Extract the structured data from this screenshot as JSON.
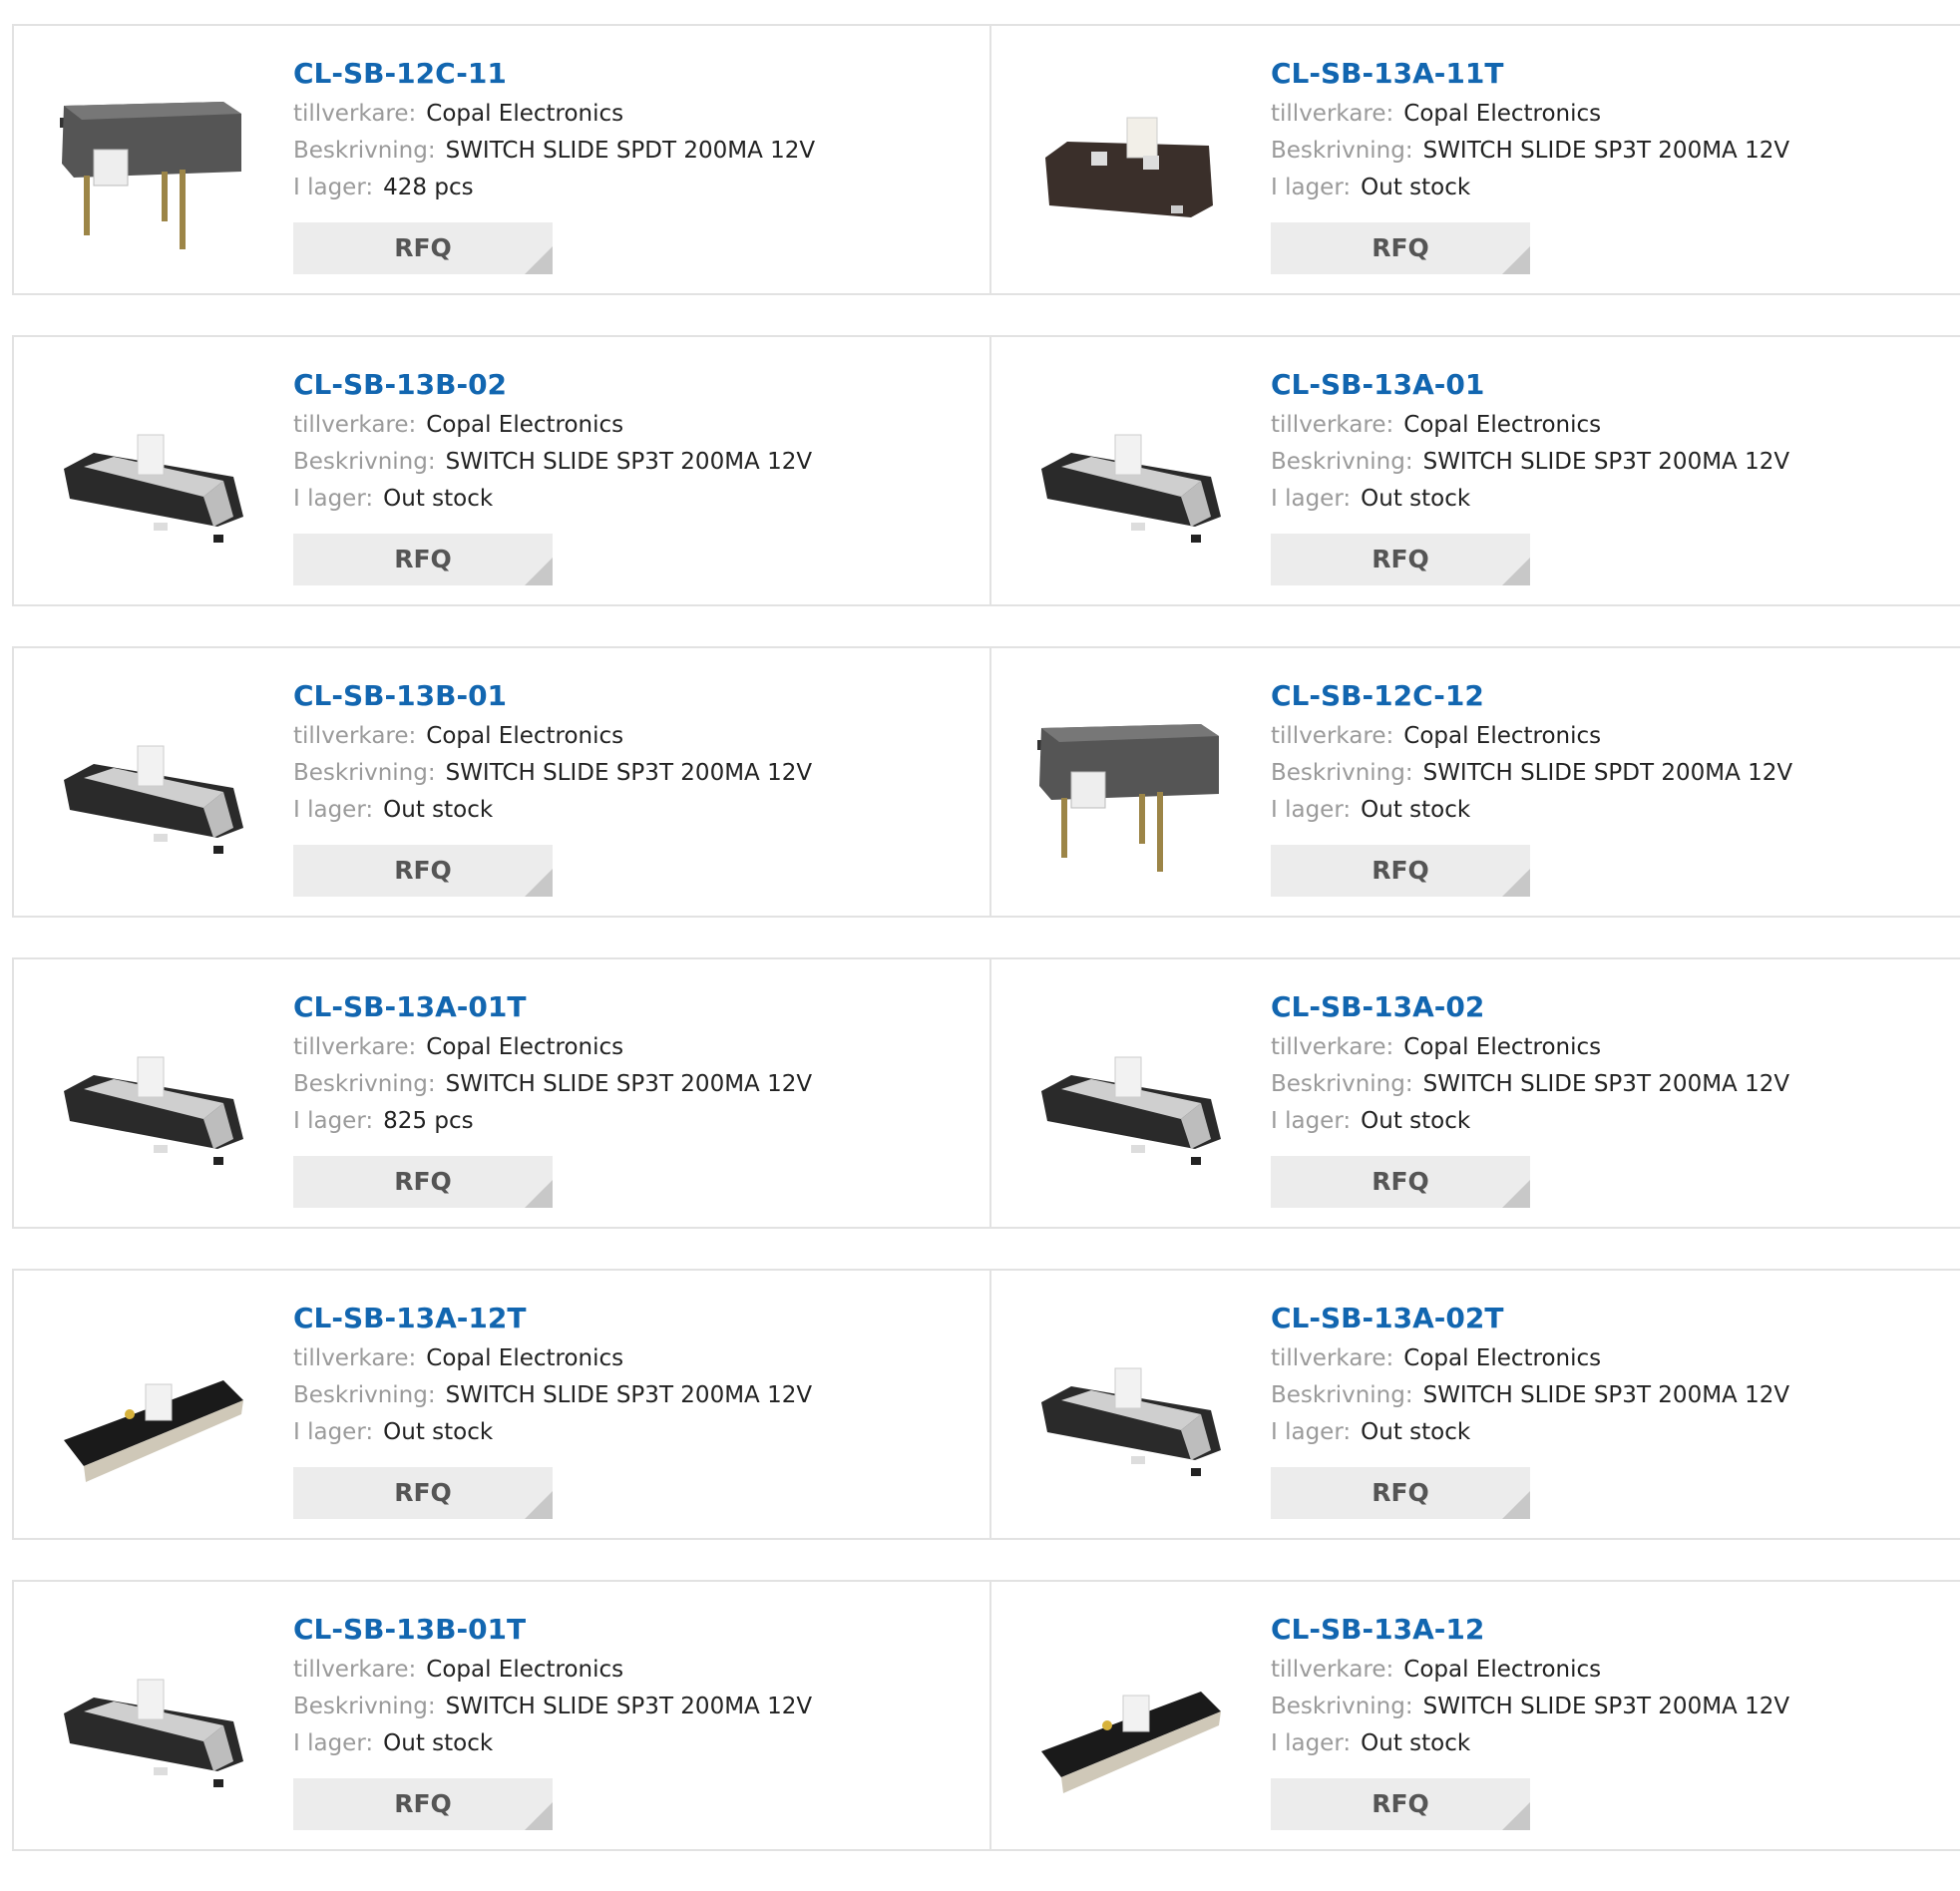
{
  "labels": {
    "manufacturer": "tillverkare:",
    "description": "Beskrivning:",
    "stock": "I lager:",
    "rfq": "RFQ"
  },
  "products": [
    {
      "part": "CL-SB-12C-11",
      "manufacturer": "Copal Electronics",
      "description": "SWITCH SLIDE SPDT 200MA 12V",
      "stock": "428 pcs",
      "icon": "slide-switch-through-hole-icon"
    },
    {
      "part": "CL-SB-13A-11T",
      "manufacturer": "Copal Electronics",
      "description": "SWITCH SLIDE SP3T 200MA 12V",
      "stock": "Out stock",
      "icon": "slide-switch-smd-dark-icon"
    },
    {
      "part": "CL-SB-13B-02",
      "manufacturer": "Copal Electronics",
      "description": "SWITCH SLIDE SP3T 200MA 12V",
      "stock": "Out stock",
      "icon": "slide-switch-smd-icon"
    },
    {
      "part": "CL-SB-13A-01",
      "manufacturer": "Copal Electronics",
      "description": "SWITCH SLIDE SP3T 200MA 12V",
      "stock": "Out stock",
      "icon": "slide-switch-smd-icon"
    },
    {
      "part": "CL-SB-13B-01",
      "manufacturer": "Copal Electronics",
      "description": "SWITCH SLIDE SP3T 200MA 12V",
      "stock": "Out stock",
      "icon": "slide-switch-smd-icon"
    },
    {
      "part": "CL-SB-12C-12",
      "manufacturer": "Copal Electronics",
      "description": "SWITCH SLIDE SPDT 200MA 12V",
      "stock": "Out stock",
      "icon": "slide-switch-through-hole-icon"
    },
    {
      "part": "CL-SB-13A-01T",
      "manufacturer": "Copal Electronics",
      "description": "SWITCH SLIDE SP3T 200MA 12V",
      "stock": "825 pcs",
      "icon": "slide-switch-smd-icon"
    },
    {
      "part": "CL-SB-13A-02",
      "manufacturer": "Copal Electronics",
      "description": "SWITCH SLIDE SP3T 200MA 12V",
      "stock": "Out stock",
      "icon": "slide-switch-smd-icon"
    },
    {
      "part": "CL-SB-13A-12T",
      "manufacturer": "Copal Electronics",
      "description": "SWITCH SLIDE SP3T 200MA 12V",
      "stock": "Out stock",
      "icon": "slide-switch-angled-icon"
    },
    {
      "part": "CL-SB-13A-02T",
      "manufacturer": "Copal Electronics",
      "description": "SWITCH SLIDE SP3T 200MA 12V",
      "stock": "Out stock",
      "icon": "slide-switch-smd-icon"
    },
    {
      "part": "CL-SB-13B-01T",
      "manufacturer": "Copal Electronics",
      "description": "SWITCH SLIDE SP3T 200MA 12V",
      "stock": "Out stock",
      "icon": "slide-switch-smd-icon"
    },
    {
      "part": "CL-SB-13A-12",
      "manufacturer": "Copal Electronics",
      "description": "SWITCH SLIDE SP3T 200MA 12V",
      "stock": "Out stock",
      "icon": "slide-switch-angled-icon"
    }
  ]
}
